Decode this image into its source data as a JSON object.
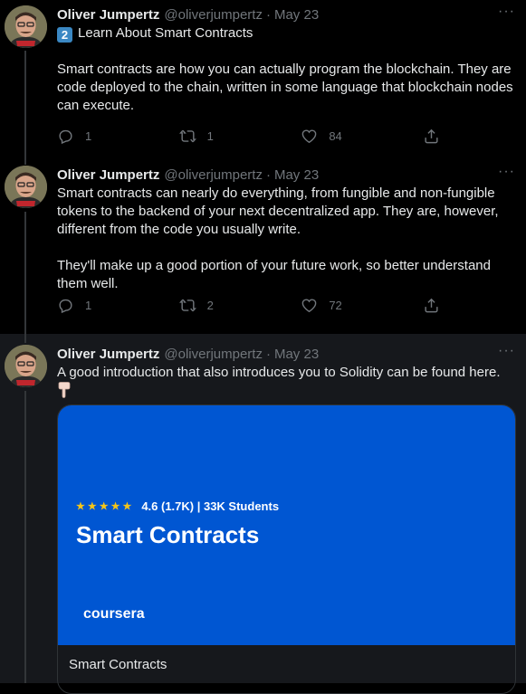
{
  "tweets": [
    {
      "author_name": "Oliver Jumpertz",
      "handle": "@oliverjumpertz",
      "separator": "·",
      "date": "May 23",
      "more_label": "···",
      "keycap": "2",
      "heading": "Learn About Smart Contracts",
      "body": "Smart contracts are how you can actually program the blockchain. They are code deployed to the chain, written in some language that blockchain nodes can execute.",
      "replies": "1",
      "retweets": "1",
      "likes": "84"
    },
    {
      "author_name": "Oliver Jumpertz",
      "handle": "@oliverjumpertz",
      "separator": "·",
      "date": "May 23",
      "more_label": "···",
      "body": "Smart contracts can nearly do everything, from fungible and non-fungible tokens to the backend of your next decentralized app. They are, however, different from the code you usually write.\n\nThey'll make up a good portion of your future work, so better understand them well.",
      "replies": "1",
      "retweets": "2",
      "likes": "72"
    },
    {
      "author_name": "Oliver Jumpertz",
      "handle": "@oliverjumpertz",
      "separator": "·",
      "date": "May 23",
      "more_label": "···",
      "body": "A good introduction that also introduces you to Solidity can be found here.",
      "card": {
        "stars": "★★★★★",
        "rating": "4.6 (1.7K) | 33K Students",
        "headline": "Smart Contracts",
        "logo": "coursera",
        "caption": "Smart Contracts",
        "background": "#0056d2"
      }
    }
  ],
  "icons": {
    "reply": "reply-icon",
    "retweet": "retweet-icon",
    "like": "heart-icon",
    "share": "share-icon",
    "keycap": "keycap-digit-two-icon",
    "pointer": "backhand-index-pointing-down-icon"
  },
  "colors": {
    "background": "#000000",
    "highlighted_background": "#16181c",
    "text": "#e7e9ea",
    "muted": "#71767b",
    "card_blue": "#0056d2"
  }
}
